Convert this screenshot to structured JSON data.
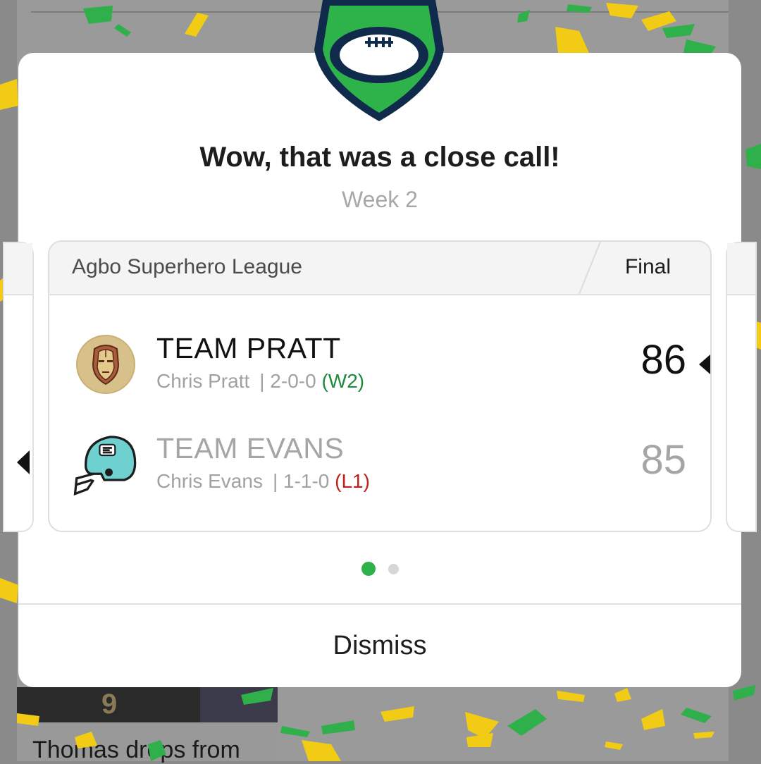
{
  "background": {
    "news_card_title": "Thomas drops from"
  },
  "modal": {
    "title": "Wow, that was a close call!",
    "subtitle": "Week 2",
    "logo_icon": "football-shield-icon",
    "matchup": {
      "league_name": "Agbo Superhero League",
      "status": "Final",
      "teams": [
        {
          "name": "TEAM PRATT",
          "owner": "Chris Pratt",
          "record": "| 2-0-0",
          "streak": "(W2)",
          "score": "86",
          "avatar_icon": "iron-man-helmet-icon",
          "winner": true
        },
        {
          "name": "TEAM EVANS",
          "owner": "Chris Evans",
          "record": "| 1-1-0",
          "streak": "(L1)",
          "score": "85",
          "avatar_icon": "football-helmet-icon",
          "winner": false
        }
      ]
    },
    "pager": {
      "current": 1,
      "total": 2
    },
    "dismiss_label": "Dismiss"
  },
  "colors": {
    "brand_green": "#2eb34a",
    "brand_navy": "#0f2a4a",
    "win_green": "#1f8a3d",
    "loss_red": "#c0201b",
    "confetti_yellow": "#f2cc14",
    "confetti_green": "#2fb04a"
  }
}
